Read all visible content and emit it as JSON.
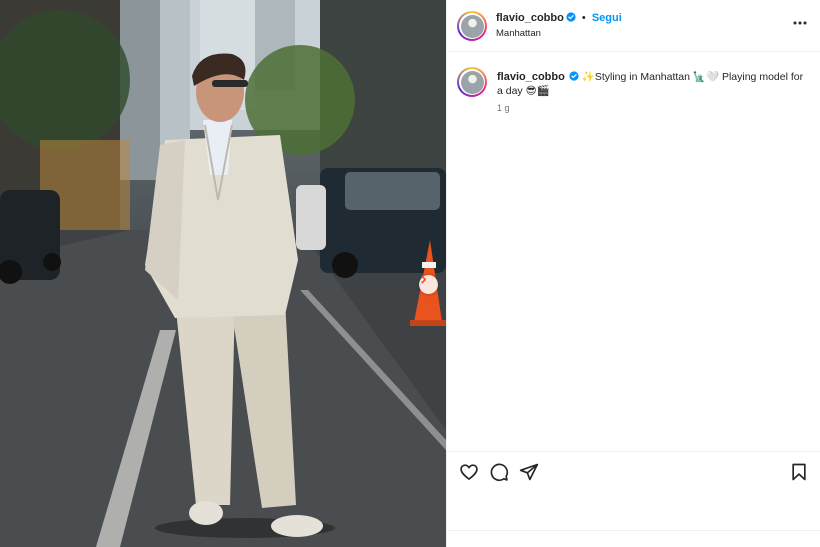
{
  "post": {
    "username": "flavio_cobbo",
    "separator": "•",
    "follow_label": "Segui",
    "location": "Manhattan",
    "caption_text": "✨Styling in Manhattan 🗽🤍 Playing model for a day 😎🎬",
    "time_ago": "1 g"
  },
  "icons": {
    "verified": "verified-badge-icon",
    "more": "more-options-icon",
    "like": "heart-icon",
    "comment": "comment-icon",
    "share": "paper-plane-icon",
    "save": "bookmark-icon",
    "next": "chevron-right-icon"
  },
  "colors": {
    "follow": "#0095f6",
    "verified": "#0095f6",
    "next_arrow": "#e8533a"
  }
}
